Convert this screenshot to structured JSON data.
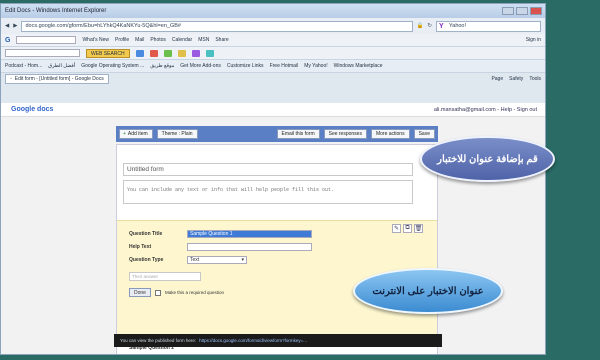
{
  "window": {
    "title": "Edit Docs - Windows Internet Explorer",
    "address": "docs.google.com/gform/Ebu=hLYhkQ4KaNKYu-5Q&hl=en_GB#",
    "search_placeholder": "Yahoo!"
  },
  "toolbar1": {
    "google_label": "G",
    "items": [
      "What's New",
      "Profile",
      "Mail",
      "Photos",
      "Calendar",
      "MSN",
      "Share",
      "Sign in"
    ]
  },
  "toolbar2": {
    "web_search": "WEB SEARCH"
  },
  "favorites": {
    "items": [
      "Podcast - Hom...",
      "أفضل الطرق",
      "Google Operating System ...",
      "موقع طريق",
      "Get More Add-ons",
      "Customize Links",
      "Free Hotmail",
      "My Yahoo!",
      "Windows Marketplace"
    ]
  },
  "tabs": {
    "active": "Edit form - [Untitled form] - Google Docs",
    "right_tools": [
      "Page",
      "Safety",
      "Tools"
    ]
  },
  "gdocs": {
    "logo": "Google docs",
    "account": "ali.mansatha@gmail.com - Help - Sign out"
  },
  "form_toolbar": {
    "add_item": "Add item",
    "theme": "Theme : Plain",
    "email_form": "Email this form",
    "see_responses": "See responses",
    "more_actions": "More actions",
    "save": "Save"
  },
  "form": {
    "title": "Untitled form",
    "description": "You can include any text or info that will help people fill this out.",
    "question_title_label": "Question Title",
    "question_title_value": "Sample Question 1",
    "help_text_label": "Help Text",
    "question_type_label": "Question Type",
    "question_type_value": "Text",
    "answer_placeholder": "Their answer",
    "done_label": "Done",
    "required_label": "Make this a required question",
    "sample2": "Sample Question 2"
  },
  "statusbar": {
    "text": "You can view the published form here:",
    "url": "https://docs.google.com/forms/d/viewform?formkey=..."
  },
  "callouts": {
    "top": "قم بإضافة عنوان للاختبار",
    "bottom": "عنوان الاختبار على الانترنت"
  },
  "colors": {
    "background": "#2a6b66",
    "form_toolbar": "#5a7fc4",
    "question_block": "#fdf6cf",
    "callout_top": "#5b6fb2",
    "callout_bottom": "#5aa4e0"
  }
}
